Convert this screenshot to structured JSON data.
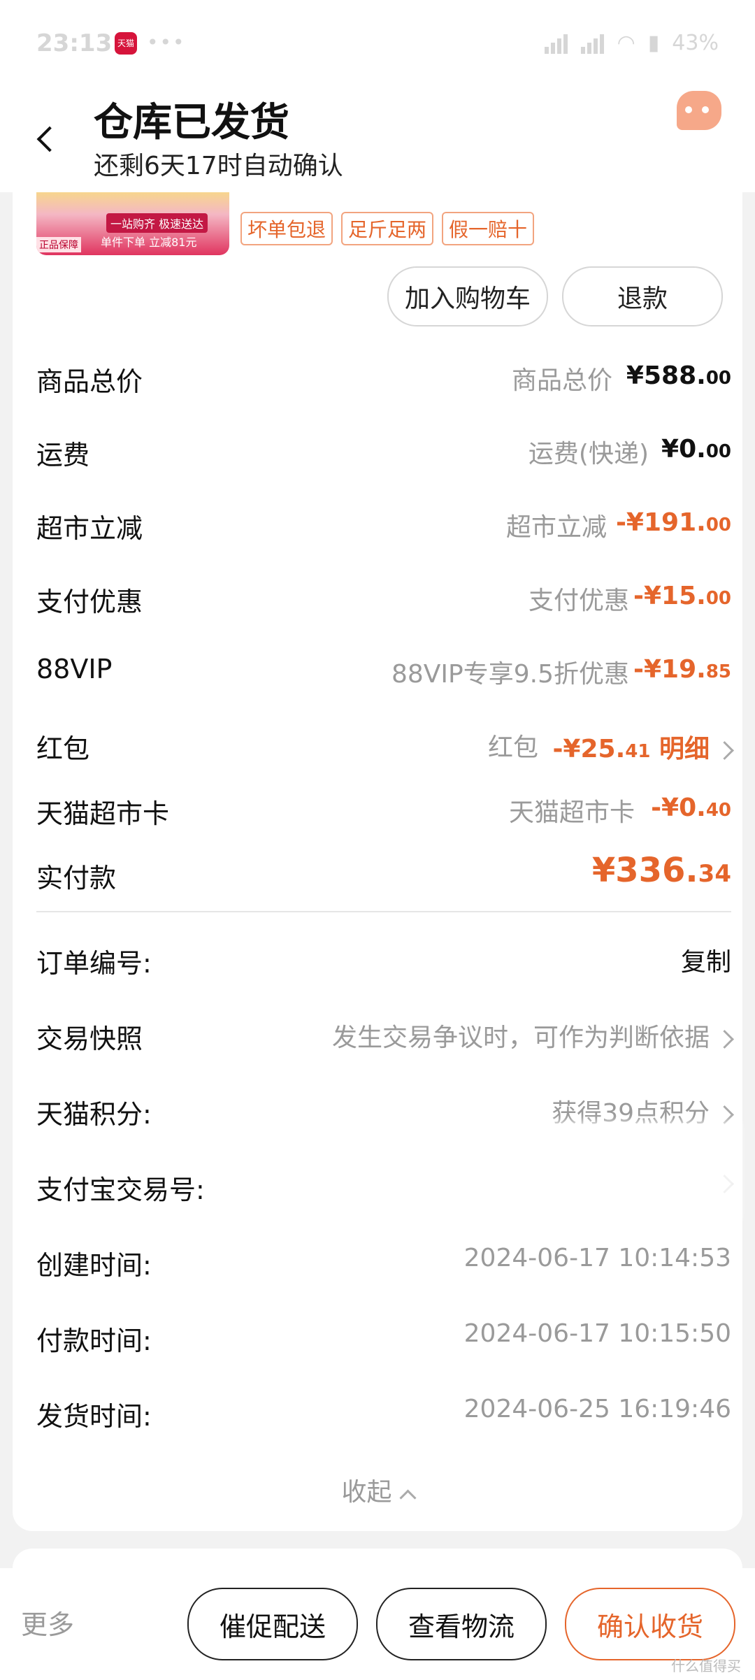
{
  "status": {
    "time": "23:13",
    "app_badge": "天猫",
    "battery": "43"
  },
  "header": {
    "title": "仓库已发货",
    "subtitle": "还剩6天17时自动确认"
  },
  "product": {
    "thumb_line1": "一站购齐 极速送达",
    "thumb_line2": "单件下单 立减81元",
    "thumb_badge": "正品保障",
    "tags": [
      "坏单包退",
      "足斤足两",
      "假一赔十"
    ],
    "actions": {
      "cart": "加入购物车",
      "refund": "退款"
    }
  },
  "costs": [
    {
      "label": "商品总价",
      "mid": "商品总价",
      "prefix": "¥",
      "int": "588.",
      "dec": "00",
      "color": "black"
    },
    {
      "label": "运费",
      "mid": "运费(快递)",
      "prefix": "¥",
      "int": "0.",
      "dec": "00",
      "color": "black"
    },
    {
      "label": "超市立减",
      "mid": "超市立减",
      "prefix": "-¥",
      "int": "191.",
      "dec": "00",
      "color": "orange"
    },
    {
      "label": "支付优惠",
      "mid": "支付优惠",
      "prefix": "-¥",
      "int": "15.",
      "dec": "00",
      "color": "orange"
    },
    {
      "label": "88VIP",
      "mid": "88VIP专享9.5折优惠",
      "prefix": "-¥",
      "int": "19.",
      "dec": "85",
      "color": "orange"
    },
    {
      "label": "红包",
      "mid": "红包",
      "prefix": "-¥",
      "int": "25.",
      "dec": "41",
      "extra": "明细",
      "color": "orange"
    },
    {
      "label": "天猫超市卡",
      "mid": "天猫超市卡",
      "prefix": "-¥",
      "int": "0.",
      "dec": "40",
      "color": "orange"
    }
  ],
  "total": {
    "label": "实付款",
    "prefix": "¥",
    "int": "336.",
    "dec": "34"
  },
  "info": {
    "order_no_label": "订单编号:",
    "order_no_action": "复制",
    "snapshot_label": "交易快照",
    "snapshot_value": "发生交易争议时，可作为判断依据",
    "points_label": "天猫积分:",
    "points_value": "获得39点积分",
    "alipay_label": "支付宝交易号:",
    "created_label": "创建时间:",
    "created_value": "2024-06-17 10:14:53",
    "paid_label": "付款时间:",
    "paid_value": "2024-06-17 10:15:50",
    "shipped_label": "发货时间:",
    "shipped_value": "2024-06-25 16:19:46",
    "collapse": "收起"
  },
  "bottom": {
    "more": "更多",
    "urge": "催促配送",
    "logistics": "查看物流",
    "confirm": "确认收货",
    "watermark": "什么值得买"
  },
  "colors": {
    "accent": "#e5652b",
    "muted": "#9a9a9a"
  }
}
